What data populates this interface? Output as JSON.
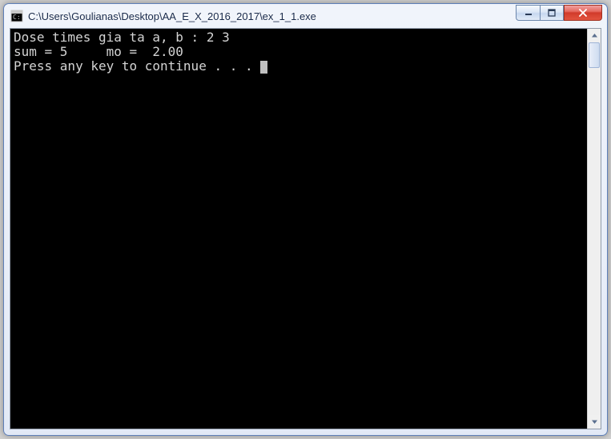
{
  "window": {
    "title": "C:\\Users\\Goulianas\\Desktop\\AA_E_X_2016_2017\\ex_1_1.exe"
  },
  "console": {
    "line1": "Dose times gia ta a, b : 2 3",
    "line2": "sum = 5     mo =  2.00",
    "line3": "Press any key to continue . . . "
  }
}
